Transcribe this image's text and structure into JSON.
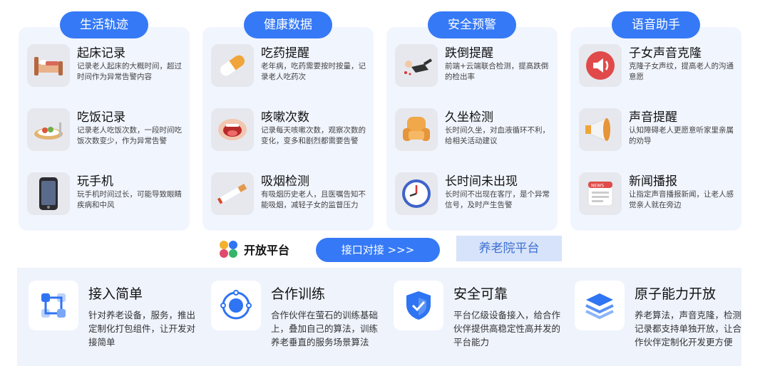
{
  "sections": [
    {
      "title": "生活轨迹",
      "items": [
        {
          "icon": "bed-icon",
          "title": "起床记录",
          "desc": "记录老人起床的大概时间，超过时间作为异常告警内容"
        },
        {
          "icon": "meal-icon",
          "title": "吃饭记录",
          "desc": "记录老人吃饭次数，一段时间吃饭次数变少，作为异常告警"
        },
        {
          "icon": "phone-icon",
          "title": "玩手机",
          "desc": "玩手机时间过长，可能导致眼睛疾病和中风"
        }
      ]
    },
    {
      "title": "健康数据",
      "items": [
        {
          "icon": "pill-icon",
          "title": "吃药提醒",
          "desc": "老年病，吃药需要按时按量，记录老人吃药次"
        },
        {
          "icon": "mouth-icon",
          "title": "咳嗽次数",
          "desc": "记录每天咳嗽次数，观察次数的变化，变多和剧烈都需要告警"
        },
        {
          "icon": "cigarette-icon",
          "title": "吸烟检测",
          "desc": "有吸烟历史老人，且医嘱告知不能吸烟，减轻子女的监督压力"
        }
      ]
    },
    {
      "title": "安全预警",
      "items": [
        {
          "icon": "fall-icon",
          "title": "跌倒提醒",
          "desc": "前端+云端联合检测，提高跌倒的检出率"
        },
        {
          "icon": "armchair-icon",
          "title": "久坐检测",
          "desc": "长时间久坐，对血液循环不利，给相关活动建议"
        },
        {
          "icon": "clock-icon",
          "title": "长时间未出现",
          "desc": "长时间不出现在客厅，是个异常信号，及时产生告警"
        }
      ]
    },
    {
      "title": "语音助手",
      "items": [
        {
          "icon": "speaker-icon",
          "title": "子女声音克隆",
          "desc": "克隆子女声纹，提高老人的沟通意愿"
        },
        {
          "icon": "megaphone-icon",
          "title": "声音提醒",
          "desc": "认知障碍老人更愿意听家里亲属的劝导"
        },
        {
          "icon": "news-icon",
          "title": "新闻播报",
          "desc": "让指定声音播报新闻，让老人感觉亲人就在旁边"
        }
      ]
    }
  ],
  "news_badge": "NEWS",
  "middle": {
    "platform_label": "开放平台",
    "interface_button": "接口对接 >>>",
    "nursing_tag": "养老院平台"
  },
  "bottom": [
    {
      "icon": "connect-icon",
      "title": "接入简单",
      "desc": "针对养老设备，服务，推出定制化打包组件，让开发对接简单"
    },
    {
      "icon": "target-icon",
      "title": "合作训练",
      "desc": "合作伙伴在萤石的训练基础上，叠加自己的算法，训练养老垂直的服务场景算法"
    },
    {
      "icon": "shield-icon",
      "title": "安全可靠",
      "desc": "平台亿级设备接入，给合作伙伴提供高稳定性高并发的平台能力"
    },
    {
      "icon": "layers-icon",
      "title": "原子能力开放",
      "desc": "养老算法，声音克隆，检测记录都支持单独开放，让合作伙伴定制化开发更方便"
    }
  ],
  "colors": {
    "accent": "#3579f6",
    "card_bg": "#f1f5fe",
    "bottom_bg": "#eef3fc",
    "tag_bg": "#d7e3fa"
  }
}
